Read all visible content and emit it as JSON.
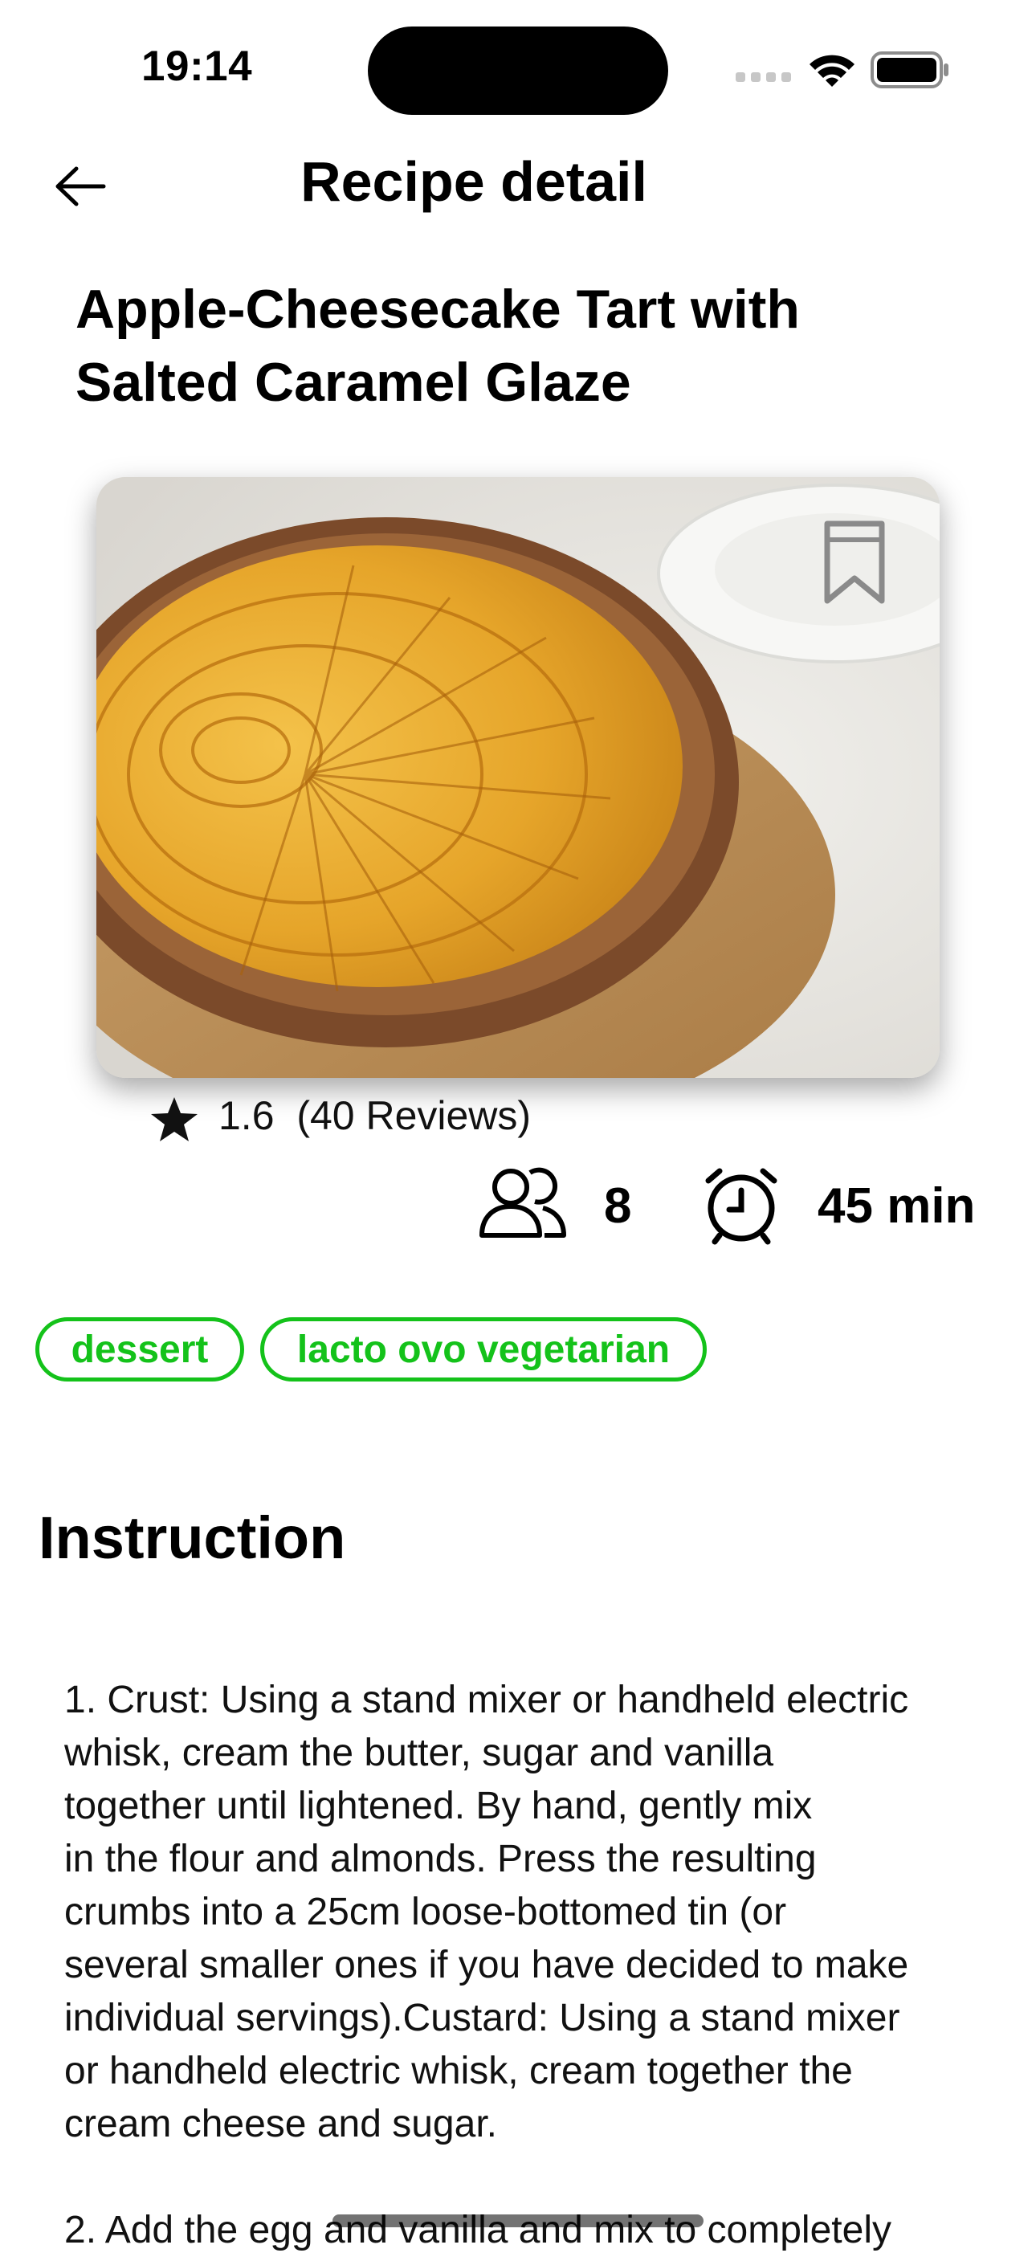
{
  "status_bar": {
    "time": "19:14",
    "icons": [
      "signal-icon",
      "wifi-icon",
      "battery-icon"
    ]
  },
  "nav": {
    "back_icon": "arrow-left-icon",
    "title": "Recipe detail"
  },
  "recipe": {
    "title": "Apple-Cheesecake Tart with Salted Caramel Glaze",
    "image_alt": "apple cheesecake tart",
    "bookmark_icon": "bookmark-icon",
    "rating": {
      "value": "1.6",
      "reviews": "(40 Reviews)",
      "icon": "star-icon"
    },
    "servings": {
      "icon": "people-icon",
      "value": "8"
    },
    "time": {
      "icon": "alarm-clock-icon",
      "value": "45 min"
    },
    "tags": [
      "dessert",
      "lacto ovo vegetarian"
    ]
  },
  "instructions": {
    "heading": "Instruction",
    "steps": [
      "1. Crust: Using a stand mixer or handheld electric\nwhisk, cream the butter, sugar and vanilla\ntogether until lightened. By hand, gently mix\nin the flour and almonds. Press the resulting\ncrumbs into a 25cm loose-bottomed tin (or\nseveral smaller ones if you have decided to make\nindividual servings).Custard: Using a stand mixer\nor handheld electric whisk, cream together the\ncream cheese and sugar.",
      "2. Add the egg and vanilla and mix to completely"
    ]
  },
  "colors": {
    "accent": "#14c21a",
    "text": "#000000",
    "background": "#ffffff"
  }
}
